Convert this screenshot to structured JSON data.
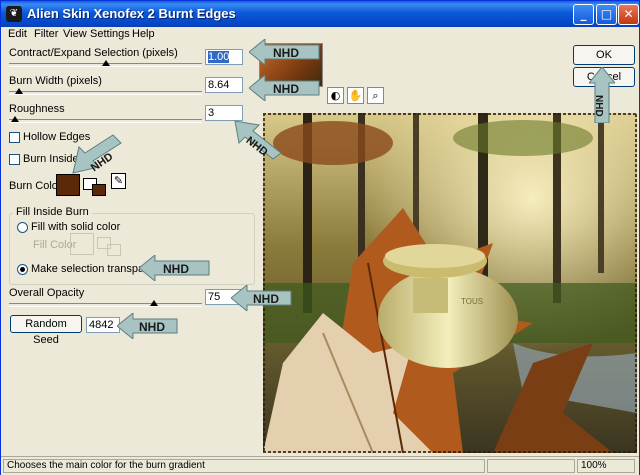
{
  "window": {
    "title": "Alien Skin Xenofex 2 Burnt Edges"
  },
  "titlebar": {
    "minimize": "_",
    "maximize": "□",
    "close": "✕"
  },
  "menu": [
    "Edit",
    "Filter",
    "View",
    "Settings",
    "Help"
  ],
  "params": {
    "contract": {
      "label": "Contract/Expand Selection (pixels)",
      "value": "1.00",
      "level": 0.5
    },
    "burn_width": {
      "label": "Burn Width (pixels)",
      "value": "8.64",
      "level": 0.05
    },
    "roughness": {
      "label": "Roughness",
      "value": "3",
      "level": 0.03
    }
  },
  "checkboxes": {
    "hollow_edges": "Hollow Edges",
    "burn_inside": "Burn Inside"
  },
  "burn_color": {
    "label": "Burn Color",
    "color": "#5a2a08"
  },
  "fill_group": {
    "title": "Fill Inside Burn",
    "solid_label": "Fill with solid color",
    "fill_color_label": "Fill Color",
    "transparent_label": "Make selection transparent"
  },
  "opacity": {
    "label": "Overall Opacity",
    "value": "75",
    "level": 0.75
  },
  "seed": {
    "button": "Random Seed",
    "value": "4842"
  },
  "buttons": {
    "ok": "OK",
    "cancel": "Cancel"
  },
  "watermark": "NHD",
  "status": {
    "text": "Chooses the main color for the burn gradient",
    "zoom": "100%"
  },
  "icons": {
    "toolbar": [
      "eye-compare-icon",
      "hand-icon",
      "zoom-icon"
    ]
  }
}
